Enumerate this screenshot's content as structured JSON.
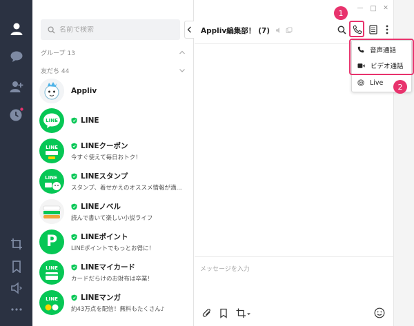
{
  "window": {
    "minimize": "—",
    "maximize": "□",
    "close": "✕"
  },
  "rail": {
    "items": [
      {
        "icon": "person-icon",
        "active": true
      },
      {
        "icon": "chat-bubble-icon",
        "active": false
      },
      {
        "icon": "add-friend-icon",
        "active": false
      },
      {
        "icon": "clock-icon",
        "active": false,
        "dot": true
      },
      {
        "icon": "crop-icon",
        "active": false
      },
      {
        "icon": "bookmark-icon",
        "active": false
      },
      {
        "icon": "speaker-icon",
        "active": false
      },
      {
        "icon": "more-icon",
        "active": false
      }
    ]
  },
  "search": {
    "placeholder": "名前で検索"
  },
  "sections": {
    "groups": {
      "label": "グループ",
      "count": "13"
    },
    "friends": {
      "label": "友だち",
      "count": "44"
    }
  },
  "contacts": [
    {
      "name": "Appliv",
      "status": "",
      "official": false,
      "avatar_text": ""
    },
    {
      "name": "LINE",
      "status": "",
      "official": true,
      "avatar_text": "LINE"
    },
    {
      "name": "LINEクーポン",
      "status": "今すぐ使えて毎日おトク！",
      "official": true,
      "avatar_text": "LINE"
    },
    {
      "name": "LINEスタンプ",
      "status": "スタンプ、着せかえのオススメ情報が満...",
      "official": true,
      "avatar_text": "LINE"
    },
    {
      "name": "LINEノベル",
      "status": "読んで書いて楽しい小説ライフ",
      "official": true,
      "avatar_text": ""
    },
    {
      "name": "LINEポイント",
      "status": "LINEポイントでもっとお得に！",
      "official": true,
      "avatar_text": "P"
    },
    {
      "name": "LINEマイカード",
      "status": "カードだらけのお財布は卒業！",
      "official": true,
      "avatar_text": "LINE"
    },
    {
      "name": "LINEマンガ",
      "status": "約43万点を配信！無料もたくさん♪",
      "official": true,
      "avatar_text": "LINE"
    }
  ],
  "chat": {
    "title": "Appliv編集部！",
    "count": "(7)",
    "input_placeholder": "メッセージを入力"
  },
  "call_menu": {
    "items": [
      {
        "label": "音声通話",
        "icon": "phone-icon"
      },
      {
        "label": "ビデオ通話",
        "icon": "video-camera-icon"
      },
      {
        "label": "Live",
        "icon": "live-icon"
      }
    ]
  },
  "annotations": {
    "step1": "1",
    "step2": "2"
  },
  "colors": {
    "accent": "#06c755",
    "rail": "#2b3242",
    "highlight": "#e8336d"
  }
}
